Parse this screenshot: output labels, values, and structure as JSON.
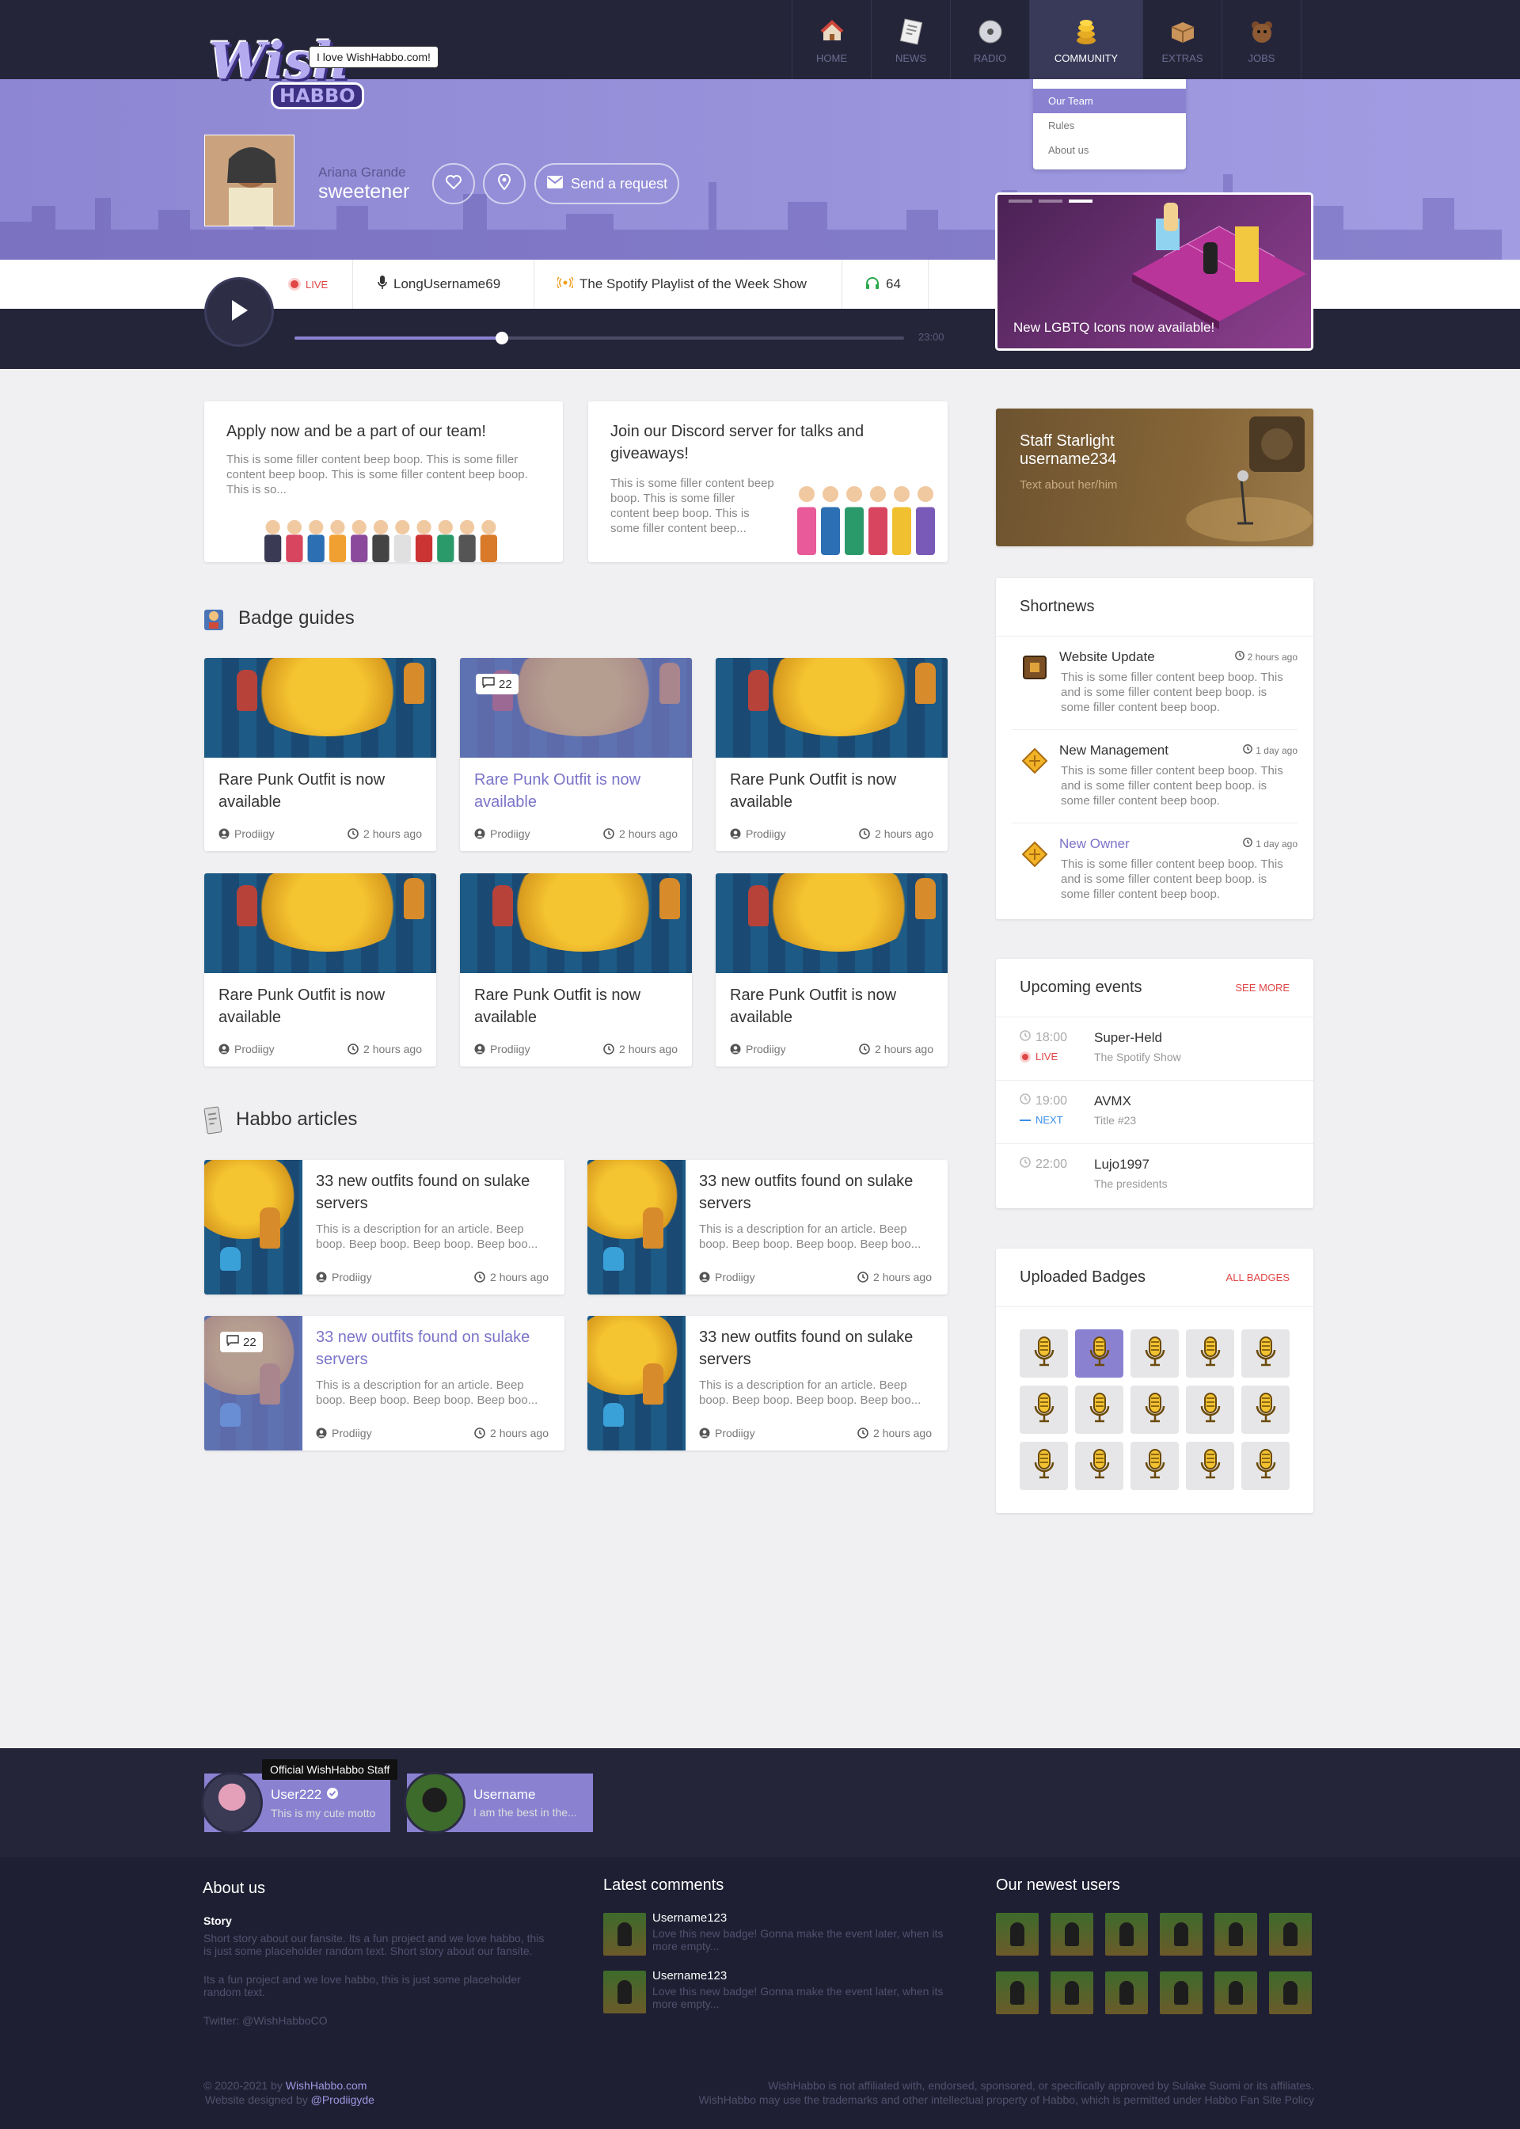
{
  "brand": {
    "bubble": "I love WishHabbo.com!",
    "logo_word": "Wish",
    "logo_sub": "HABBO"
  },
  "nav": [
    {
      "label": "HOME",
      "icon": "home-icon"
    },
    {
      "label": "NEWS",
      "icon": "news-icon"
    },
    {
      "label": "RADIO",
      "icon": "radio-icon"
    },
    {
      "label": "COMMUNITY",
      "icon": "coins-icon",
      "active": true
    },
    {
      "label": "EXTRAS",
      "icon": "box-icon"
    },
    {
      "label": "JOBS",
      "icon": "bear-icon"
    }
  ],
  "dropdown": [
    "Our Team",
    "Rules",
    "About us"
  ],
  "profile": {
    "song_artist": "Ariana Grande",
    "song_title": "sweetener",
    "request_label": "Send a request"
  },
  "promo": {
    "caption": "New LGBTQ Icons now available!"
  },
  "player": {
    "live": "LIVE",
    "dj": "LongUsername69",
    "show": "The Spotify Playlist of the Week Show",
    "listeners": "64",
    "end_time": "23:00",
    "progress": 0.34
  },
  "teasers": [
    {
      "title": "Apply now and be a part of our team!",
      "body": "This is some filler content beep boop. This is some filler content beep boop. This is some filler content beep boop. This is so..."
    },
    {
      "title": "Join our Discord server for talks and giveaways!",
      "body": "This is some filler content beep boop. This is some filler content beep boop. This is some filler content beep..."
    }
  ],
  "badge_guides": {
    "title": "Badge guides",
    "items": [
      {
        "title": "Rare Punk Outfit is now available",
        "author": "Prodiigy",
        "time": "2 hours ago"
      },
      {
        "title": "Rare Punk Outfit is now available",
        "author": "Prodiigy",
        "time": "2 hours ago",
        "comments": "22",
        "hover": true
      },
      {
        "title": "Rare Punk Outfit is now available",
        "author": "Prodiigy",
        "time": "2 hours ago"
      },
      {
        "title": "Rare Punk Outfit is now available",
        "author": "Prodiigy",
        "time": "2 hours ago"
      },
      {
        "title": "Rare Punk Outfit is now available",
        "author": "Prodiigy",
        "time": "2 hours ago"
      },
      {
        "title": "Rare Punk Outfit is now available",
        "author": "Prodiigy",
        "time": "2 hours ago"
      }
    ]
  },
  "articles": {
    "title": "Habbo articles",
    "items": [
      {
        "title": "33 new outfits found on sulake servers",
        "body": "This is a description for an article. Beep boop. Beep boop. Beep boop. Beep boo...",
        "author": "Prodiigy",
        "time": "2 hours ago"
      },
      {
        "title": "33 new outfits found on sulake servers",
        "body": "This is a description for an article. Beep boop. Beep boop. Beep boop. Beep boo...",
        "author": "Prodiigy",
        "time": "2 hours ago"
      },
      {
        "title": "33 new outfits found on sulake servers",
        "body": "This is a description for an article. Beep boop. Beep boop. Beep boop. Beep boo...",
        "author": "Prodiigy",
        "time": "2 hours ago",
        "comments": "22",
        "hover": true
      },
      {
        "title": "33 new outfits found on sulake servers",
        "body": "This is a description for an article. Beep boop. Beep boop. Beep boop. Beep boo...",
        "author": "Prodiigy",
        "time": "2 hours ago"
      }
    ]
  },
  "staff_star": {
    "title": "Staff Starlight",
    "username": "username234",
    "text": "Text about her/him"
  },
  "shortnews": {
    "title": "Shortnews",
    "items": [
      {
        "title": "Website Update",
        "date": "2 hours ago",
        "body": "This is some filler content beep boop. This and is some filler content beep boop. is some filler content beep boop."
      },
      {
        "title": "New Management",
        "date": "1 day ago",
        "body": "This is some filler content beep boop. This and is some filler content beep boop. is some filler content beep boop."
      },
      {
        "title": "New Owner",
        "date": "1 day ago",
        "body": "This is some filler content beep boop. This and is some filler content beep boop. is some filler content beep boop.",
        "highlight": true
      }
    ]
  },
  "events": {
    "title": "Upcoming events",
    "more": "SEE MORE",
    "items": [
      {
        "time": "18:00",
        "status": "LIVE",
        "name": "Super-Held",
        "sub": "The Spotify Show"
      },
      {
        "time": "19:00",
        "status": "NEXT",
        "name": "AVMX",
        "sub": "Title #23"
      },
      {
        "time": "22:00",
        "status": "",
        "name": "Lujo1997",
        "sub": "The presidents"
      }
    ]
  },
  "badges": {
    "title": "Uploaded Badges",
    "more": "ALL BADGES",
    "count": 15,
    "selected": 1
  },
  "staff": {
    "tooltip": "Official WishHabbo Staff",
    "members": [
      {
        "name": "User222",
        "motto": "This is my cute motto"
      },
      {
        "name": "Username",
        "motto": "I am the best in the..."
      }
    ]
  },
  "footer": {
    "about_title": "About us",
    "story_title": "Story",
    "story": "Short story about our fansite. Its a fun project and we love habbo, this is just some placeholder random text. Short story about our fansite.",
    "story2": "Its a fun project and we love habbo, this is just some placeholder random text.",
    "twitter": "Twitter: @WishHabboCO",
    "comments_title": "Latest comments",
    "comments": [
      {
        "user": "Username123",
        "text": "Love this new badge! Gonna make the event later, when its more empty..."
      },
      {
        "user": "Username123",
        "text": "Love this new badge! Gonna make the event later, when its more empty..."
      }
    ],
    "newest_title": "Our newest users",
    "copyright_prefix": "© 2020-2021 by ",
    "copyright_site": "WishHabbo.com",
    "designed_prefix": "Website designed by ",
    "designer": "@Prodiigyde",
    "disclaimer1": "WishHabbo is not affiliated with, endorsed, sponsored, or specifically approved by Sulake Suomi or its affiliates.",
    "disclaimer2": "WishHabbo may use the trademarks and other intellectual property of Habbo, which is permitted under Habbo Fan Site Policy"
  },
  "colors": {
    "accent": "#8a82d1",
    "header": "#25253a",
    "live": "#e04646",
    "next": "#3a8ee6"
  }
}
